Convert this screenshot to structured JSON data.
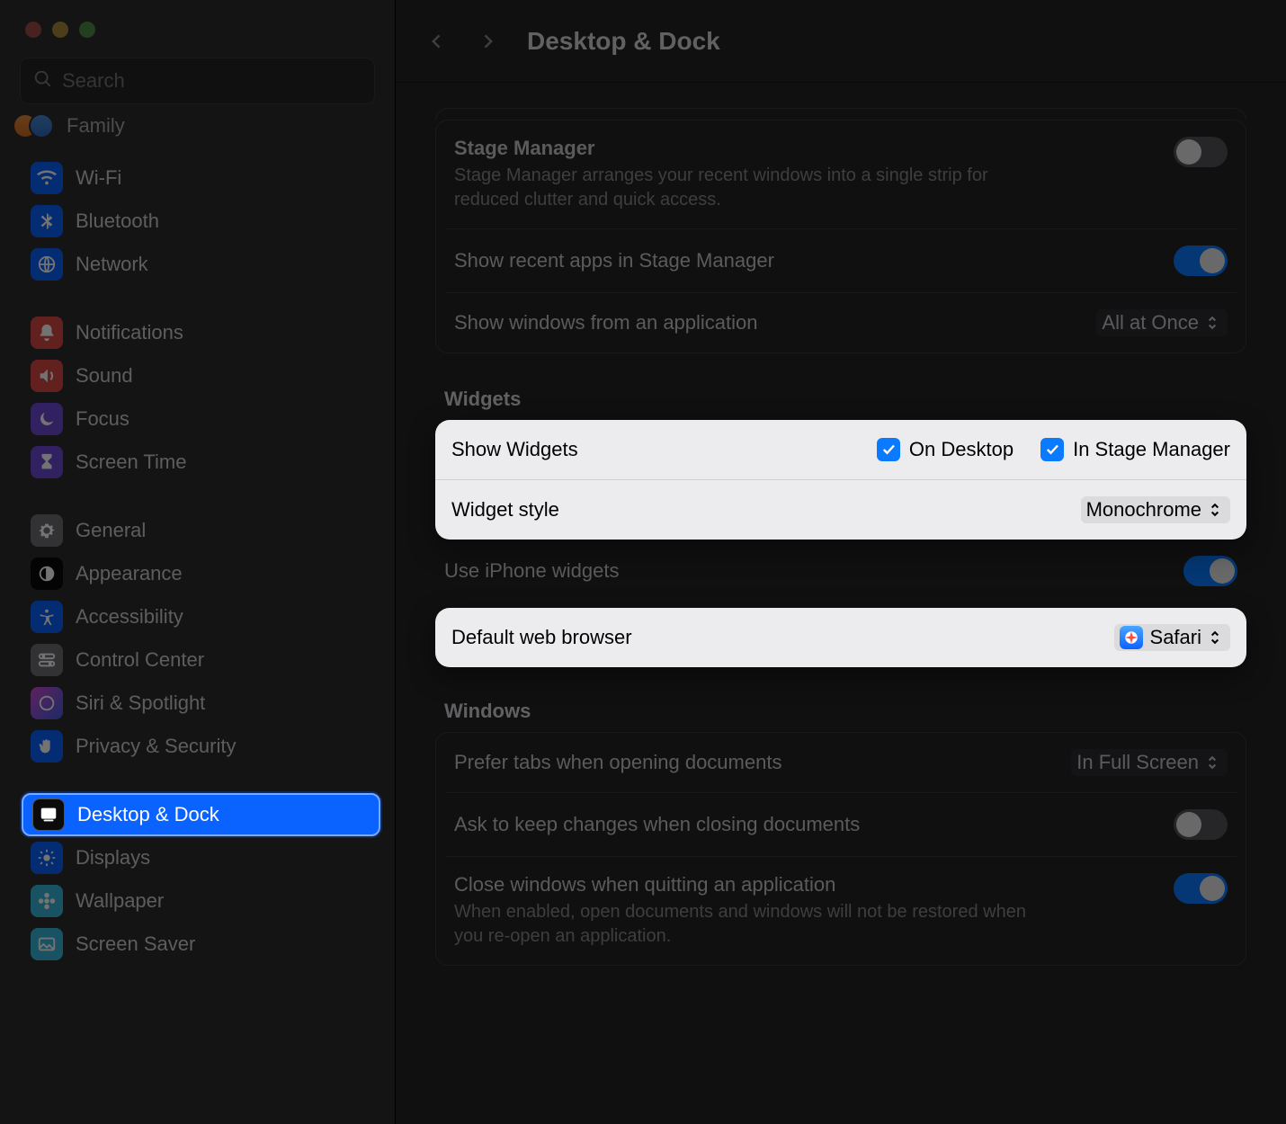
{
  "window": {
    "title": "Desktop & Dock"
  },
  "search": {
    "placeholder": "Search"
  },
  "sidebar": {
    "family_label": "Family",
    "items": [
      {
        "label": "Wi-Fi",
        "icon": "wifi-icon"
      },
      {
        "label": "Bluetooth",
        "icon": "bluetooth-icon"
      },
      {
        "label": "Network",
        "icon": "globe-icon"
      },
      {
        "label": "Notifications",
        "icon": "bell-icon"
      },
      {
        "label": "Sound",
        "icon": "speaker-icon"
      },
      {
        "label": "Focus",
        "icon": "moon-icon"
      },
      {
        "label": "Screen Time",
        "icon": "hourglass-icon"
      },
      {
        "label": "General",
        "icon": "gear-icon"
      },
      {
        "label": "Appearance",
        "icon": "appearance-icon"
      },
      {
        "label": "Accessibility",
        "icon": "accessibility-icon"
      },
      {
        "label": "Control Center",
        "icon": "switches-icon"
      },
      {
        "label": "Siri & Spotlight",
        "icon": "siri-icon"
      },
      {
        "label": "Privacy & Security",
        "icon": "hand-icon"
      },
      {
        "label": "Desktop & Dock",
        "icon": "dock-icon",
        "selected": true
      },
      {
        "label": "Displays",
        "icon": "sun-icon"
      },
      {
        "label": "Wallpaper",
        "icon": "flower-icon"
      },
      {
        "label": "Screen Saver",
        "icon": "photo-icon"
      }
    ]
  },
  "content": {
    "stage": {
      "title": "Stage Manager",
      "desc": "Stage Manager arranges your recent windows into a single strip for reduced clutter and quick access.",
      "enabled": false,
      "recents_label": "Show recent apps in Stage Manager",
      "recents_on": true,
      "windows_label": "Show windows from an application",
      "windows_value": "All at Once"
    },
    "widgets": {
      "header": "Widgets",
      "show_label": "Show Widgets",
      "on_desktop_label": "On Desktop",
      "on_desktop_checked": true,
      "in_stage_label": "In Stage Manager",
      "in_stage_checked": true,
      "style_label": "Widget style",
      "style_value": "Monochrome",
      "iphone_label": "Use iPhone widgets",
      "iphone_on": true
    },
    "browser": {
      "label": "Default web browser",
      "value": "Safari"
    },
    "windows": {
      "header": "Windows",
      "tabs_label": "Prefer tabs when opening documents",
      "tabs_value": "In Full Screen",
      "ask_label": "Ask to keep changes when closing documents",
      "ask_on": false,
      "close_label": "Close windows when quitting an application",
      "close_on": true,
      "close_desc": "When enabled, open documents and windows will not be restored when you re-open an application."
    }
  }
}
